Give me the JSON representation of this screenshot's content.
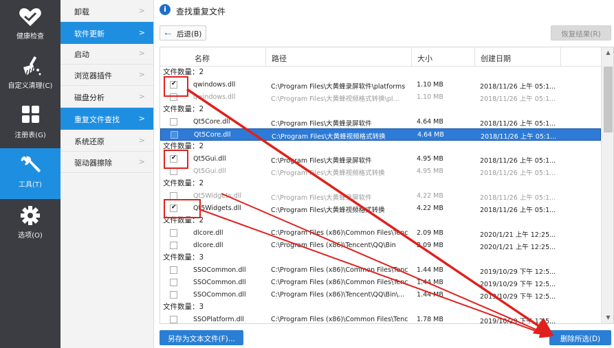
{
  "leftnav": [
    {
      "id": "health",
      "label": "健康检查",
      "icon": "heart-icon"
    },
    {
      "id": "custom",
      "label": "自定义清理(C)",
      "icon": "broom-icon"
    },
    {
      "id": "registry",
      "label": "注册表(G)",
      "icon": "grid-icon"
    },
    {
      "id": "tools",
      "label": "工具(T)",
      "icon": "wrench-icon"
    },
    {
      "id": "options",
      "label": "选项(O)",
      "icon": "gear-icon"
    }
  ],
  "subnav": [
    {
      "label": "卸载",
      "active": false
    },
    {
      "label": "软件更新",
      "active": true
    },
    {
      "label": "启动",
      "active": false
    },
    {
      "label": "浏览器插件",
      "active": false
    },
    {
      "label": "磁盘分析",
      "active": false
    },
    {
      "label": "重复文件查找",
      "active": true
    },
    {
      "label": "系统还原",
      "active": false
    },
    {
      "label": "驱动器擦除",
      "active": false
    }
  ],
  "title": "查找重复文件",
  "toolbar": {
    "back_label": "后退(B)",
    "restore_label": "恢复结果(R)"
  },
  "columns": {
    "name": "名称",
    "path": "路径",
    "size": "大小",
    "date": "创建日期"
  },
  "group_prefix": "文件数量：",
  "groups": [
    {
      "count": "2",
      "rows": [
        {
          "name": "qwindows.dll",
          "path": "C:\\Program Files\\大黄蜂录屏软件\\platforms",
          "size": "1.10 MB",
          "date": "2018/11/26 上午 05:1...",
          "checked": true,
          "state": "norm"
        },
        {
          "name": "qwindows.dll",
          "path": "C:\\Program Files\\大黄蜂视频格式转换\\pl...",
          "size": "1.10 MB",
          "date": "2018/11/26 上午 05:1...",
          "checked": false,
          "state": "dim"
        }
      ]
    },
    {
      "count": "2",
      "rows": [
        {
          "name": "Qt5Core.dll",
          "path": "C:\\Program Files\\大黄蜂录屏软件",
          "size": "4.64 MB",
          "date": "2018/11/26 上午 05:1...",
          "checked": false,
          "state": "norm"
        },
        {
          "name": "Qt5Core.dll",
          "path": "C:\\Program Files\\大黄蜂视频格式转换",
          "size": "4.64 MB",
          "date": "2018/11/26 上午 05:1...",
          "checked": false,
          "state": "sel"
        }
      ]
    },
    {
      "count": "2",
      "rows": [
        {
          "name": "Qt5Gui.dll",
          "path": "C:\\Program Files\\大黄蜂录屏软件",
          "size": "4.95 MB",
          "date": "2018/11/26 上午 05:1...",
          "checked": true,
          "state": "norm"
        },
        {
          "name": "Qt5Gui.dll",
          "path": "C:\\Program Files\\大黄蜂视频格式转换",
          "size": "4.95 MB",
          "date": "2018/11/26 上午 05:1...",
          "checked": false,
          "state": "dim"
        }
      ]
    },
    {
      "count": "2",
      "rows": [
        {
          "name": "Qt5Widgets.dll",
          "path": "C:\\Program Files\\大黄蜂录屏软件",
          "size": "4.22 MB",
          "date": "2018/11/26 上午 05:1...",
          "checked": false,
          "state": "dim"
        },
        {
          "name": "Qt5Widgets.dll",
          "path": "C:\\Program Files\\大黄蜂视频格式转换",
          "size": "4.22 MB",
          "date": "2018/11/26 上午 05:1...",
          "checked": true,
          "state": "norm"
        }
      ]
    },
    {
      "count": "2",
      "rows": [
        {
          "name": "dlcore.dll",
          "path": "C:\\Program Files (x86)\\Common Files\\Tenc...",
          "size": "2.09 MB",
          "date": "2020/1/21 上午 12:25...",
          "checked": false,
          "state": "norm"
        },
        {
          "name": "dlcore.dll",
          "path": "C:\\Program Files (x86)\\Tencent\\QQ\\Bin",
          "size": "2.09 MB",
          "date": "2020/1/21 上午 12:25...",
          "checked": false,
          "state": "norm"
        }
      ]
    },
    {
      "count": "3",
      "rows": [
        {
          "name": "SSOCommon.dll",
          "path": "C:\\Program Files (x86)\\Common Files\\Tenc...",
          "size": "1.44 MB",
          "date": "2019/10/29 下午 12:5...",
          "checked": false,
          "state": "norm"
        },
        {
          "name": "SSOCommon.dll",
          "path": "C:\\Program Files (x86)\\Common Files\\Tenc...",
          "size": "1.44 MB",
          "date": "2019/10/29 下午 12:5...",
          "checked": false,
          "state": "norm"
        },
        {
          "name": "SSOCommon.dll",
          "path": "C:\\Program Files (x86)\\Tencent\\QQ\\Bin\\...",
          "size": "1.44 MB",
          "date": "2019/10/29 下午 12:5...",
          "checked": false,
          "state": "norm"
        }
      ]
    },
    {
      "count": "3",
      "rows": [
        {
          "name": "SSOPlatform.dll",
          "path": "C:\\Program Files (x86)\\Common Files\\Tenc...",
          "size": "1.78 MB",
          "date": "2019/10/29 下午 12:5...",
          "checked": false,
          "state": "norm"
        }
      ]
    }
  ],
  "bottom": {
    "export_label": "另存为文本文件(F)...",
    "delete_label": "删除所选(D)"
  },
  "colors": {
    "accent": "#1e8fe0",
    "sidebar": "#3b3d42",
    "annotation": "#e0201c"
  }
}
